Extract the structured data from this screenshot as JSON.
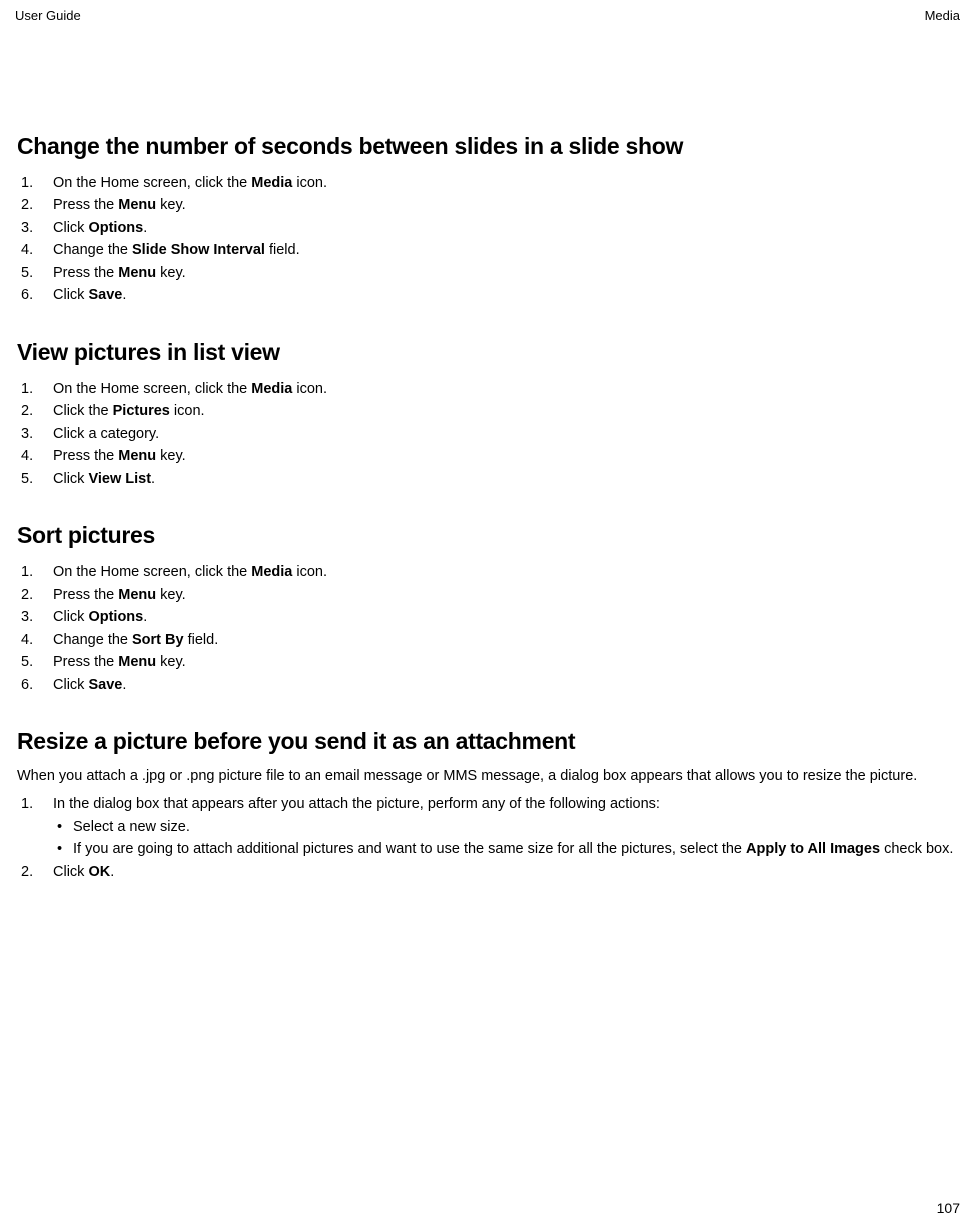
{
  "header": {
    "left": "User Guide",
    "right": "Media"
  },
  "pageNumber": "107",
  "sections": [
    {
      "title": "Change the number of seconds between slides in a slide show",
      "steps": [
        [
          {
            "t": "On the Home screen, click the "
          },
          {
            "t": "Media",
            "b": true
          },
          {
            "t": " icon."
          }
        ],
        [
          {
            "t": "Press the "
          },
          {
            "t": "Menu",
            "b": true
          },
          {
            "t": " key."
          }
        ],
        [
          {
            "t": "Click "
          },
          {
            "t": "Options",
            "b": true
          },
          {
            "t": "."
          }
        ],
        [
          {
            "t": "Change the "
          },
          {
            "t": "Slide Show Interval",
            "b": true
          },
          {
            "t": " field."
          }
        ],
        [
          {
            "t": "Press the "
          },
          {
            "t": "Menu",
            "b": true
          },
          {
            "t": " key."
          }
        ],
        [
          {
            "t": "Click "
          },
          {
            "t": "Save",
            "b": true
          },
          {
            "t": "."
          }
        ]
      ]
    },
    {
      "title": "View pictures in list view",
      "steps": [
        [
          {
            "t": "On the Home screen, click the "
          },
          {
            "t": "Media",
            "b": true
          },
          {
            "t": " icon."
          }
        ],
        [
          {
            "t": "Click the "
          },
          {
            "t": "Pictures",
            "b": true
          },
          {
            "t": " icon."
          }
        ],
        [
          {
            "t": "Click a category."
          }
        ],
        [
          {
            "t": "Press the "
          },
          {
            "t": "Menu",
            "b": true
          },
          {
            "t": " key."
          }
        ],
        [
          {
            "t": "Click "
          },
          {
            "t": "View List",
            "b": true
          },
          {
            "t": "."
          }
        ]
      ]
    },
    {
      "title": "Sort pictures",
      "steps": [
        [
          {
            "t": "On the Home screen, click the "
          },
          {
            "t": "Media",
            "b": true
          },
          {
            "t": " icon."
          }
        ],
        [
          {
            "t": "Press the "
          },
          {
            "t": "Menu",
            "b": true
          },
          {
            "t": " key."
          }
        ],
        [
          {
            "t": "Click "
          },
          {
            "t": "Options",
            "b": true
          },
          {
            "t": "."
          }
        ],
        [
          {
            "t": "Change the "
          },
          {
            "t": "Sort By",
            "b": true
          },
          {
            "t": " field."
          }
        ],
        [
          {
            "t": "Press the "
          },
          {
            "t": "Menu",
            "b": true
          },
          {
            "t": " key."
          }
        ],
        [
          {
            "t": "Click "
          },
          {
            "t": "Save",
            "b": true
          },
          {
            "t": "."
          }
        ]
      ]
    },
    {
      "title": "Resize a picture before you send it as an attachment",
      "intro": "When you attach a .jpg or .png picture file to an email message or MMS message, a dialog box appears that allows you to resize the picture.",
      "steps": [
        {
          "parts": [
            {
              "t": "In the dialog box that appears after you attach the picture, perform any of the following actions:"
            }
          ],
          "sub": [
            [
              {
                "t": "Select a new size."
              }
            ],
            [
              {
                "t": "If you are going to attach additional pictures and want to use the same size for all the pictures, select the "
              },
              {
                "t": "Apply to All Images",
                "b": true
              },
              {
                "t": " check box."
              }
            ]
          ]
        },
        [
          {
            "t": "Click "
          },
          {
            "t": "OK",
            "b": true
          },
          {
            "t": "."
          }
        ]
      ]
    }
  ]
}
